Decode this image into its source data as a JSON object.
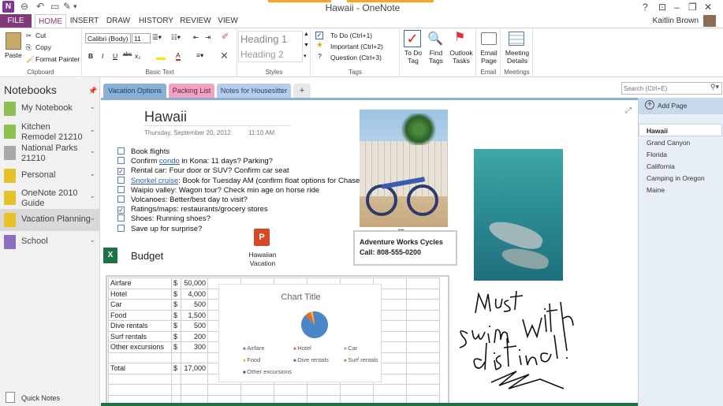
{
  "window": {
    "title": "Hawaii - OneNote",
    "user": "Kaitlin Brown",
    "help": "?"
  },
  "ribbon_tabs": [
    "FILE",
    "HOME",
    "INSERT",
    "DRAW",
    "HISTORY",
    "REVIEW",
    "VIEW"
  ],
  "ribbon": {
    "clipboard": {
      "paste": "Paste",
      "cut": "Cut",
      "copy": "Copy",
      "format_painter": "Format Painter",
      "label": "Clipboard"
    },
    "basic_text": {
      "font": "Calibri (Body)",
      "size": "11",
      "bold": "B",
      "italic": "I",
      "underline": "U",
      "strike": "abc",
      "sub": "x₂",
      "label": "Basic Text"
    },
    "styles": {
      "h1": "Heading 1",
      "h2": "Heading 2",
      "label": "Styles"
    },
    "tags": {
      "todo": "To Do (Ctrl+1)",
      "important": "Important (Ctrl+2)",
      "question": "Question (Ctrl+3)",
      "label": "Tags"
    },
    "todo_tag": "To Do Tag",
    "find_tags": "Find Tags",
    "outlook_tasks": "Outlook Tasks",
    "email": {
      "btn": "Email Page",
      "label": "Email"
    },
    "meetings": {
      "btn": "Meeting Details",
      "label": "Meetings"
    }
  },
  "notebooks": {
    "header": "Notebooks",
    "items": [
      {
        "label": "My Notebook",
        "color": "#8cc04f"
      },
      {
        "label": "Kitchen Remodel 21210",
        "color": "#8cc04f"
      },
      {
        "label": "National Parks 21210",
        "color": "#a9a9a9"
      },
      {
        "label": "Personal",
        "color": "#e8c22a"
      },
      {
        "label": "OneNote 2010 Guide",
        "color": "#e8c22a"
      },
      {
        "label": "Vacation Planning",
        "color": "#e8c22a"
      },
      {
        "label": "School",
        "color": "#8e6cc0"
      }
    ],
    "quick_notes": "Quick Notes"
  },
  "section_tabs": [
    "Vacation Options",
    "Packing List",
    "Notes for Housesitter",
    "+"
  ],
  "search_placeholder": "Search (Ctrl+E)",
  "pages": {
    "add": "Add Page",
    "items": [
      "Hawaii",
      "Grand Canyon",
      "Florida",
      "California",
      "Camping in Oregon",
      "Maine"
    ]
  },
  "page": {
    "title": "Hawaii",
    "date": "Thursday, September 20, 2012",
    "time": "11:10 AM",
    "todos": [
      {
        "checked": false,
        "pre": "Book flights",
        "link": "",
        "post": ""
      },
      {
        "checked": false,
        "pre": "Confirm ",
        "link": "condo",
        "post": " in Kona: 11 days? Parking?"
      },
      {
        "checked": true,
        "pre": "Rental car: Four door or SUV? Confirm car seat",
        "link": "",
        "post": ""
      },
      {
        "checked": false,
        "pre": "",
        "link": "Snorkel cruise",
        "post": ": Book for Tuesday AM (confirm float options for Chase)"
      },
      {
        "checked": false,
        "pre": "Waipio valley: Wagon tour? Check min age on horse ride",
        "link": "",
        "post": ""
      },
      {
        "checked": false,
        "pre": "Volcanoes: Better/best day to visit?",
        "link": "",
        "post": ""
      },
      {
        "checked": true,
        "pre": "Ratings/maps: restaurants/grocery stores",
        "link": "",
        "post": ""
      },
      {
        "checked": false,
        "pre": "Shoes: Running shoes?",
        "link": "",
        "post": ""
      },
      {
        "checked": false,
        "pre": "Save up for surprise?",
        "link": "",
        "post": ""
      }
    ],
    "attachment": "Hawaiian Vacation",
    "budget_title": "Budget",
    "budget": [
      {
        "item": "Airfare",
        "cur": "$",
        "amt": "50,000"
      },
      {
        "item": "Hotel",
        "cur": "$",
        "amt": "4,000"
      },
      {
        "item": "Car",
        "cur": "$",
        "amt": "500"
      },
      {
        "item": "Food",
        "cur": "$",
        "amt": "1,500"
      },
      {
        "item": "Dive rentals",
        "cur": "$",
        "amt": "500"
      },
      {
        "item": "Surf rentals",
        "cur": "$",
        "amt": "200"
      },
      {
        "item": "Other excursions",
        "cur": "$",
        "amt": "300"
      },
      {
        "item": "",
        "cur": "",
        "amt": ""
      },
      {
        "item": "Total",
        "cur": "$",
        "amt": "17,000"
      }
    ],
    "chart": {
      "title": "Chart Title",
      "type": "pie",
      "legend": [
        "Airfare",
        "Hotel",
        "Car",
        "Food",
        "Dive rentals",
        "Surf rentals",
        "Other excursions"
      ],
      "colors": [
        "#4a86c8",
        "#e46c2b",
        "#a5a5a5",
        "#f2b923",
        "#3a64b0",
        "#6cab46",
        "#264b8c"
      ]
    },
    "note": {
      "line1": "Adventure Works Cycles",
      "line2": "Call: 808-555-0200"
    },
    "ink": "Must swim with dolphins!"
  },
  "chart_data": {
    "type": "pie",
    "title": "Chart Title",
    "categories": [
      "Airfare",
      "Hotel",
      "Car",
      "Food",
      "Dive rentals",
      "Surf rentals",
      "Other excursions"
    ],
    "values": [
      50000,
      4000,
      500,
      1500,
      500,
      200,
      300
    ]
  }
}
